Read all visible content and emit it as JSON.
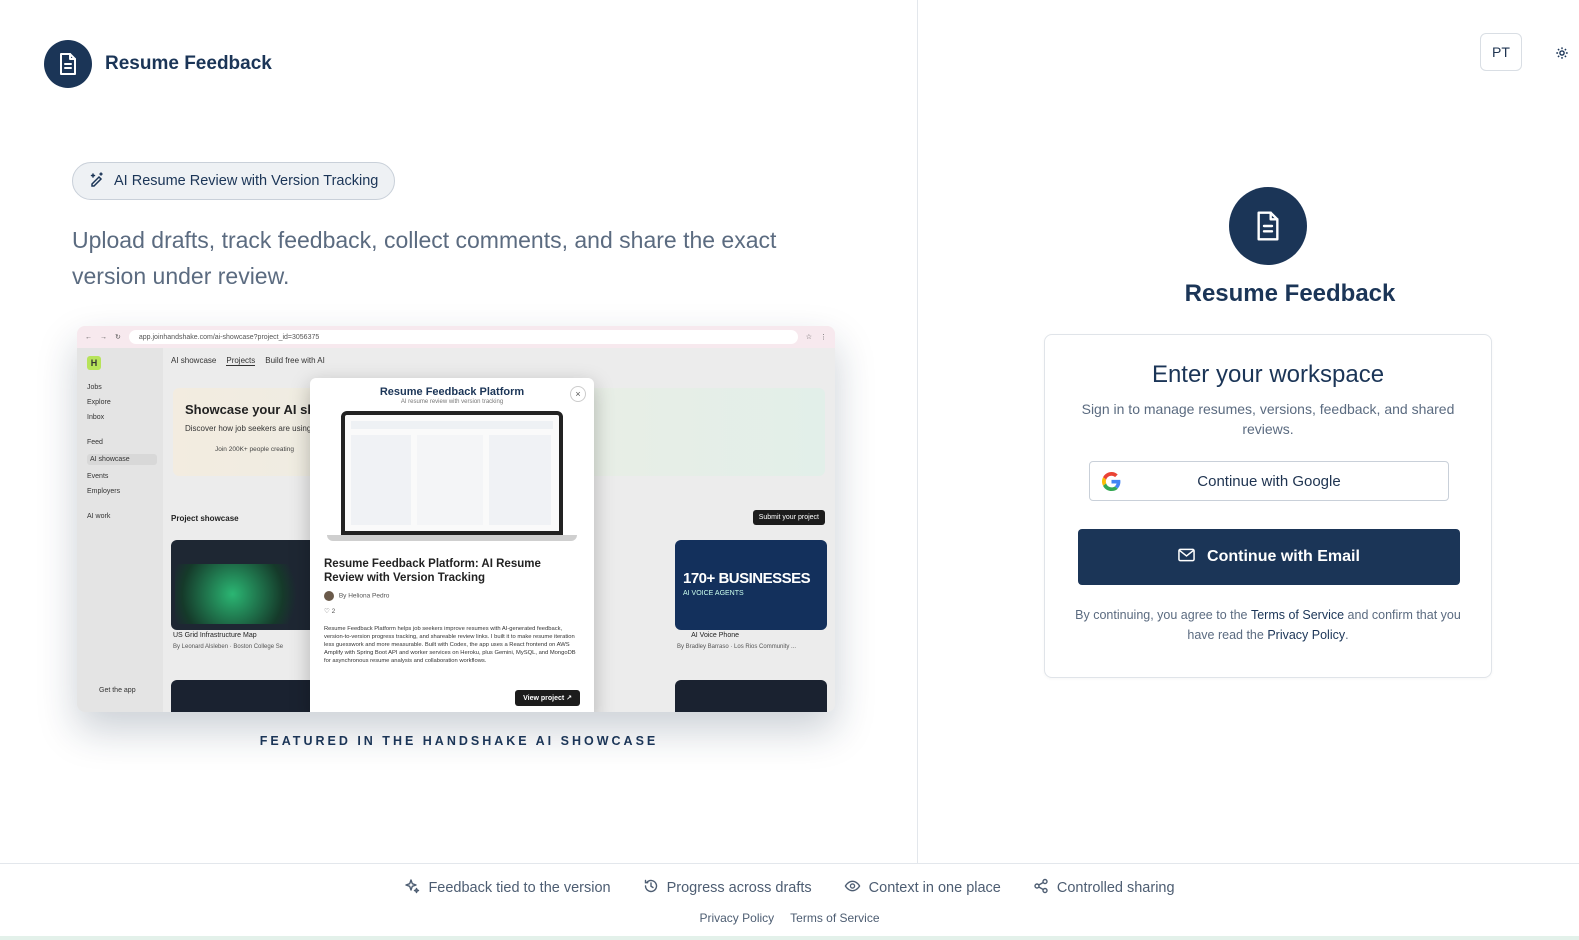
{
  "brand": {
    "name": "Resume Feedback"
  },
  "hero": {
    "pill": "AI Resume Review with Version Tracking",
    "tagline": "Upload drafts, track feedback, collect comments, and share the exact version under review.",
    "featured_caption": "FEATURED IN THE HANDSHAKE AI SHOWCASE"
  },
  "screenshot": {
    "url": "app.joinhandshake.com/ai-showcase?project_id=3056375",
    "tabs": [
      "AI showcase",
      "Projects",
      "Build free with AI"
    ],
    "sidebar": [
      "Jobs",
      "Explore",
      "Inbox",
      "Feed",
      "AI showcase",
      "Events",
      "Employers",
      "AI work"
    ],
    "get_app": "Get the app",
    "banner_title": "Showcase your AI sk",
    "banner_sub": "Discover how job seekers are using",
    "banner_join": "Join 200K+ people creating",
    "section": "Project showcase",
    "submit": "Submit your project",
    "card_left_title": "US Grid Infrastructure Map",
    "card_left_by": "By Leonard Alsleben · Boston College Se",
    "card_right_title": "AI Voice Phone",
    "card_right_by": "By Bradley Barraso · Los Rios Community ...",
    "card_right_banner": "170+ BUSINESSES",
    "card_right_banner_sub": "AI VOICE AGENTS",
    "modal_title": "Resume Feedback Platform",
    "modal_sub": "AI resume review with version tracking",
    "modal_heading": "Resume Feedback Platform: AI Resume Review with Version Tracking",
    "modal_by": "By Heliona Pedro",
    "modal_likes": "2",
    "modal_body": "Resume Feedback Platform helps job seekers improve resumes with AI-generated feedback, version-to-version progress tracking, and shareable review links. I built it to make resume iteration less guesswork and more measurable. Built with Codex, the app uses a React frontend on AWS Amplify with Spring Boot API and worker services on Heroku, plus Gemini, MySQL, and MongoDB for asynchronous resume analysis and collaboration workflows.",
    "modal_button": "View project ↗"
  },
  "header": {
    "avatar_initials": "PT"
  },
  "auth": {
    "title": "Resume Feedback",
    "card_title": "Enter your workspace",
    "card_desc": "Sign in to manage resumes, versions, feedback, and shared reviews.",
    "google_label": "Continue with Google",
    "email_label": "Continue with Email",
    "legal_prefix": "By continuing, you agree to the ",
    "terms_link": "Terms of Service",
    "legal_mid": " and confirm that you have read the ",
    "privacy_link": "Privacy Policy",
    "legal_suffix": "."
  },
  "footer": {
    "features": [
      "Feedback tied to the version",
      "Progress across drafts",
      "Context in one place",
      "Controlled sharing"
    ],
    "links": [
      "Privacy Policy",
      "Terms of Service"
    ]
  },
  "colors": {
    "navy": "#1b3557",
    "muted": "#5b6b80",
    "border": "#e0e4e9"
  }
}
